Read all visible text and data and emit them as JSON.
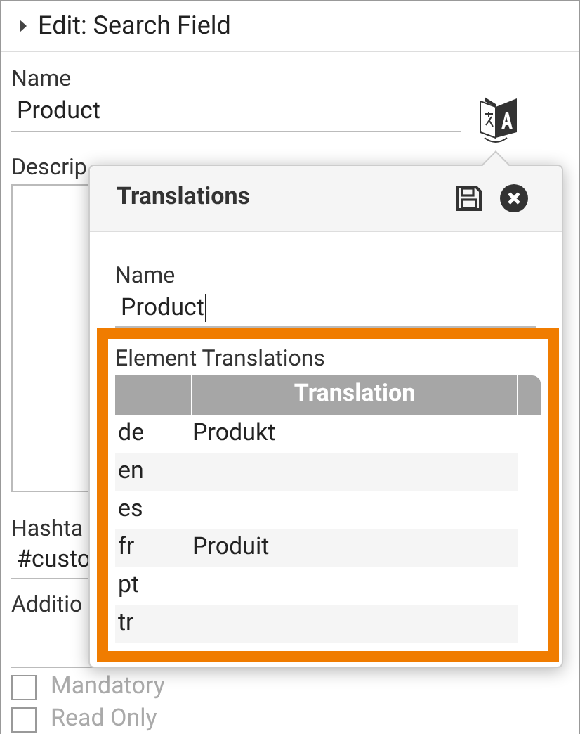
{
  "panel": {
    "title": "Edit: Search Field"
  },
  "form": {
    "name_label": "Name",
    "name_value": "Product",
    "description_label": "Descrip",
    "hashtags_label": "Hashta",
    "hashtags_value": "#custo",
    "additional_label": "Additio",
    "checkboxes": [
      {
        "label": "Mandatory",
        "checked": false
      },
      {
        "label": "Read Only",
        "checked": false
      }
    ]
  },
  "translations": {
    "title": "Translations",
    "name_label": "Name",
    "name_value": "Product",
    "section_label": "Element Translations",
    "columns": [
      "Translation"
    ],
    "rows": [
      {
        "language": "de",
        "translation": "Produkt"
      },
      {
        "language": "en",
        "translation": ""
      },
      {
        "language": "es",
        "translation": ""
      },
      {
        "language": "fr",
        "translation": "Produit"
      },
      {
        "language": "pt",
        "translation": ""
      },
      {
        "language": "tr",
        "translation": ""
      }
    ]
  }
}
